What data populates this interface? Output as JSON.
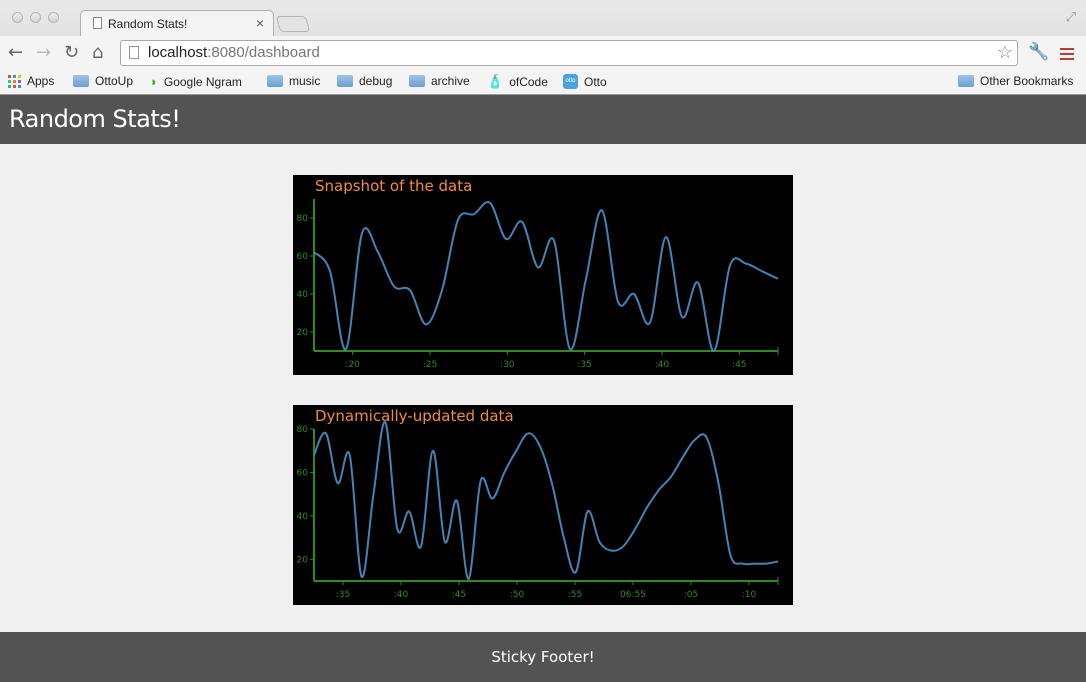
{
  "browser": {
    "tab_title": "Random Stats!",
    "tab_close": "×",
    "url_host": "localhost",
    "url_rest": ":8080/dashboard",
    "bookmarks": [
      {
        "label": "Apps",
        "icon": "apps-grid-icon"
      },
      {
        "label": "OttoUp",
        "icon": "folder-icon"
      },
      {
        "label": "Google Ngram",
        "icon": "feed-icon"
      },
      {
        "label": "music",
        "icon": "folder-icon"
      },
      {
        "label": "debug",
        "icon": "folder-icon"
      },
      {
        "label": "archive",
        "icon": "folder-icon"
      },
      {
        "label": "ofCode",
        "icon": "bottle-icon"
      },
      {
        "label": "Otto",
        "icon": "otto-icon"
      }
    ],
    "other_bookmarks": "Other Bookmarks",
    "otto_icon_text": "otto"
  },
  "header": {
    "title": "Random Stats!"
  },
  "footer": {
    "text": "Sticky Footer!"
  },
  "colors": {
    "line": "#4682b4",
    "axis": "#2e8b22",
    "title": "#f28c3c",
    "bar": "#535353"
  },
  "chart_data": [
    {
      "type": "line",
      "title": "Snapshot of the data",
      "ylim": [
        10,
        90
      ],
      "yticks": [
        20,
        40,
        60,
        80
      ],
      "xticks": [
        ":20",
        ":25",
        ":30",
        ":35",
        ":40",
        ":45"
      ],
      "xrange": [
        20,
        49
      ],
      "x": [
        20,
        21,
        22,
        23,
        24,
        25,
        26,
        27,
        28,
        29,
        30,
        31,
        32,
        33,
        34,
        35,
        36,
        37,
        38,
        39,
        40,
        41,
        42,
        43,
        44,
        45,
        46,
        47,
        48,
        49
      ],
      "values": [
        62,
        52,
        11,
        72,
        62,
        44,
        42,
        24,
        42,
        79,
        82,
        88,
        69,
        78,
        54,
        68,
        11,
        48,
        84,
        36,
        40,
        25,
        70,
        28,
        46,
        10,
        55,
        56,
        52,
        48
      ]
    },
    {
      "type": "line",
      "title": "Dynamically-updated data",
      "ylim": [
        10,
        80
      ],
      "yticks": [
        20,
        40,
        60,
        80
      ],
      "xticks": [
        ":35",
        ":40",
        ":45",
        ":50",
        ":55",
        "06:55",
        ":05",
        ":10"
      ],
      "xrange": [
        32,
        71
      ],
      "x": [
        32,
        33,
        34,
        35,
        36,
        37,
        38,
        39,
        40,
        41,
        42,
        43,
        44,
        45,
        46,
        47,
        48,
        49,
        50,
        51,
        52,
        53,
        54,
        55,
        56,
        57,
        58,
        59,
        60,
        61,
        62,
        63,
        64,
        65,
        66,
        67,
        68,
        69,
        70,
        71
      ],
      "values": [
        68,
        78,
        55,
        68,
        12,
        50,
        83,
        34,
        42,
        26,
        70,
        28,
        47,
        11,
        56,
        48,
        60,
        70,
        78,
        72,
        55,
        30,
        14,
        42,
        28,
        24,
        26,
        34,
        44,
        52,
        58,
        67,
        75,
        76,
        55,
        22,
        18,
        18,
        18,
        19
      ]
    }
  ]
}
